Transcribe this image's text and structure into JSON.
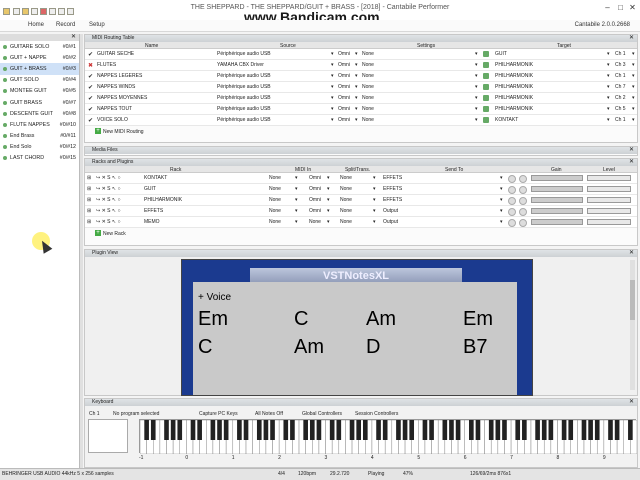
{
  "window": {
    "title": "THE SHEPPARD - THE SHEPPARD/GUIT + BRASS - [2018] - Cantabile Performer",
    "watermark": "www.Bandicam.com"
  },
  "menu": {
    "items": [
      "Home",
      "Record",
      "Setup"
    ],
    "version": "Cantabile 2.0.0.2668"
  },
  "songs": [
    {
      "name": "GUITARE SOLO",
      "num": "#0/#1"
    },
    {
      "name": "GUIT + NAPPE",
      "num": "#0/#2"
    },
    {
      "name": "GUIT + BRASS",
      "num": "#0/#3"
    },
    {
      "name": "GUIT SOLO",
      "num": "#0/#4"
    },
    {
      "name": "MONTEE GUIT",
      "num": "#0/#5"
    },
    {
      "name": "GUIT BRASS",
      "num": "#0/#7"
    },
    {
      "name": "DESCENTE GUIT",
      "num": "#0/#8"
    },
    {
      "name": "FLUTE NAPPES",
      "num": "#0/#10"
    },
    {
      "name": "End Brass",
      "num": "#0/#11"
    },
    {
      "name": "End Solo",
      "num": "#0/#12"
    },
    {
      "name": "LAST CHORD",
      "num": "#0/#15"
    }
  ],
  "midi_routing": {
    "title": "MIDI Routing Table",
    "cols": [
      "Name",
      "Source",
      "Settings",
      "Target"
    ],
    "rows": [
      {
        "check": "✔",
        "name": "GUITAR SECHE",
        "source": "Périphérique audio USB",
        "omni": "Omni",
        "none": "None",
        "target": "GUIT",
        "ch": "Ch 1"
      },
      {
        "check": "✖",
        "name": "FLUTES",
        "source": "YAMAHA CBX Driver",
        "omni": "Omni",
        "none": "None",
        "target": "PHILHARMONIK",
        "ch": "Ch 3"
      },
      {
        "check": "✔",
        "name": "NAPPES LEGERES",
        "source": "Périphérique audio USB",
        "omni": "Omni",
        "none": "None",
        "target": "PHILHARMONIK",
        "ch": "Ch 1"
      },
      {
        "check": "✔",
        "name": "NAPPES WINDS",
        "source": "Périphérique audio USB",
        "omni": "Omni",
        "none": "None",
        "target": "PHILHARMONIK",
        "ch": "Ch 7"
      },
      {
        "check": "✔",
        "name": "NAPPES MOYENNES",
        "source": "Périphérique audio USB",
        "omni": "Omni",
        "none": "None",
        "target": "PHILHARMONIK",
        "ch": "Ch 2"
      },
      {
        "check": "✔",
        "name": "NAPPES TOUT",
        "source": "Périphérique audio USB",
        "omni": "Omni",
        "none": "None",
        "target": "PHILHARMONIK",
        "ch": "Ch 5"
      },
      {
        "check": "✔",
        "name": "VOICE SOLO",
        "source": "Périphérique audio USB",
        "omni": "Omni",
        "none": "None",
        "target": "KONTAKT",
        "ch": "Ch 1"
      }
    ],
    "add_label": "New MIDI Routing"
  },
  "media_files": {
    "title": "Media Files"
  },
  "racks": {
    "title": "Racks and Plugins",
    "cols": [
      "Rack",
      "MIDI In",
      "Split/Trans.",
      "Send To",
      "Gain",
      "Level"
    ],
    "rows": [
      {
        "name": "KONTAKT",
        "midi": "None",
        "omni": "Omni",
        "split": "None",
        "send": "EFFETS"
      },
      {
        "name": "GUIT",
        "midi": "None",
        "omni": "Omni",
        "split": "None",
        "send": "EFFETS"
      },
      {
        "name": "PHILHARMONIK",
        "midi": "None",
        "omni": "Omni",
        "split": "None",
        "send": "EFFETS"
      },
      {
        "name": "EFFETS",
        "midi": "None",
        "omni": "Omni",
        "split": "None",
        "send": "Output"
      },
      {
        "name": "MEMO",
        "midi": "None",
        "omni": "None",
        "split": "None",
        "send": "Output"
      }
    ],
    "add_label": "New Rack"
  },
  "plugin_view": {
    "title": "Plugin View",
    "logo": "VSTNotesXL",
    "voice": "+ Voice",
    "chords_row1": [
      "Em",
      "C",
      "Am",
      "Em"
    ],
    "chords_row2": [
      "C",
      "Am",
      "D",
      "B7"
    ]
  },
  "keyboard": {
    "title": "Keyboard",
    "channel": "Ch 1",
    "program": "No program selected",
    "capture": "Capture PC Keys",
    "notes_off": "All Notes Off",
    "global": "Global Controllers",
    "session": "Session Controllers",
    "octaves": [
      "-1",
      "0",
      "1",
      "2",
      "3",
      "4",
      "5",
      "6",
      "7",
      "8",
      "9"
    ]
  },
  "status": {
    "device": "BEHRINGER USB AUDIO 44kHz 5 x 256 samples",
    "time": "4/4",
    "bpm": "120bpm",
    "pos": "29.2.720",
    "state": "Playing",
    "load": "47%",
    "mem": "126/69/2ms 876x1"
  }
}
